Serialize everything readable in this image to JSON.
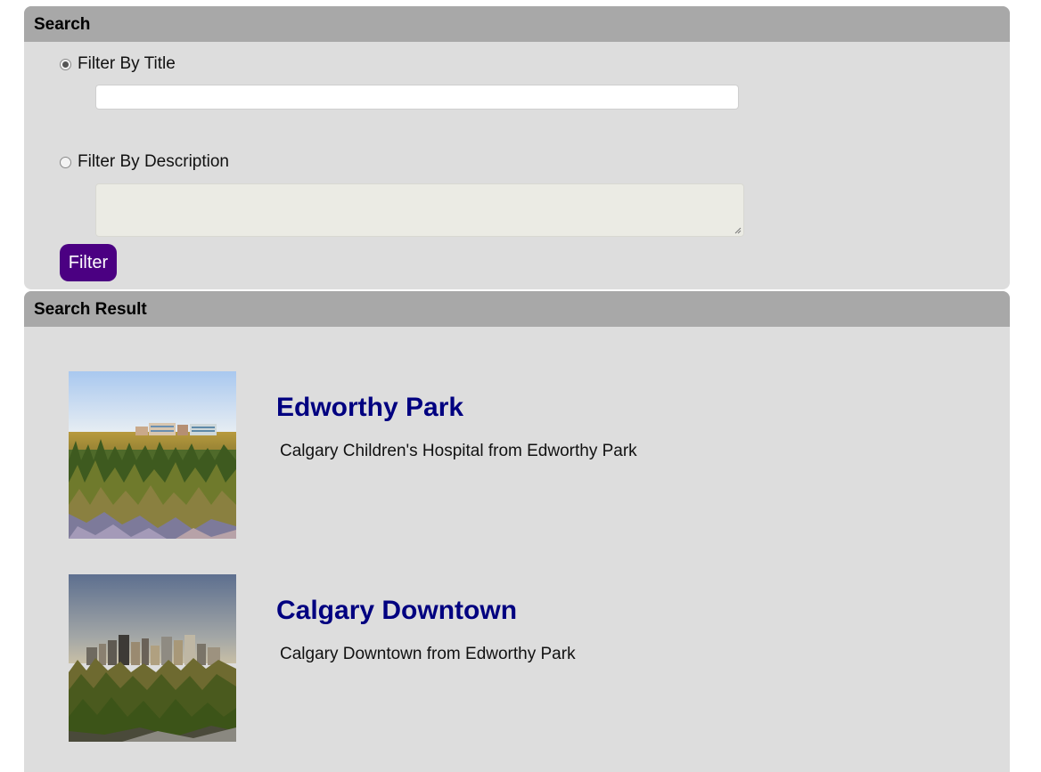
{
  "search_panel": {
    "header": "Search",
    "title_filter_label": "Filter By Title",
    "title_filter_value": "",
    "description_filter_label": "Filter By Description",
    "description_filter_value": "",
    "selected_filter": "title",
    "filter_button_label": "Filter"
  },
  "results_panel": {
    "header": "Search Result",
    "items": [
      {
        "title": "Edworthy Park",
        "description": "Calgary Children's Hospital from Edworthy Park",
        "image": "edworthy-park-photo"
      },
      {
        "title": "Calgary Downtown",
        "description": "Calgary Downtown from Edworthy Park",
        "image": "calgary-downtown-photo"
      }
    ]
  },
  "colors": {
    "panel_background": "#dddddd",
    "header_background": "#a8a8a8",
    "button_background": "#4b0082",
    "title_link": "#000080"
  }
}
